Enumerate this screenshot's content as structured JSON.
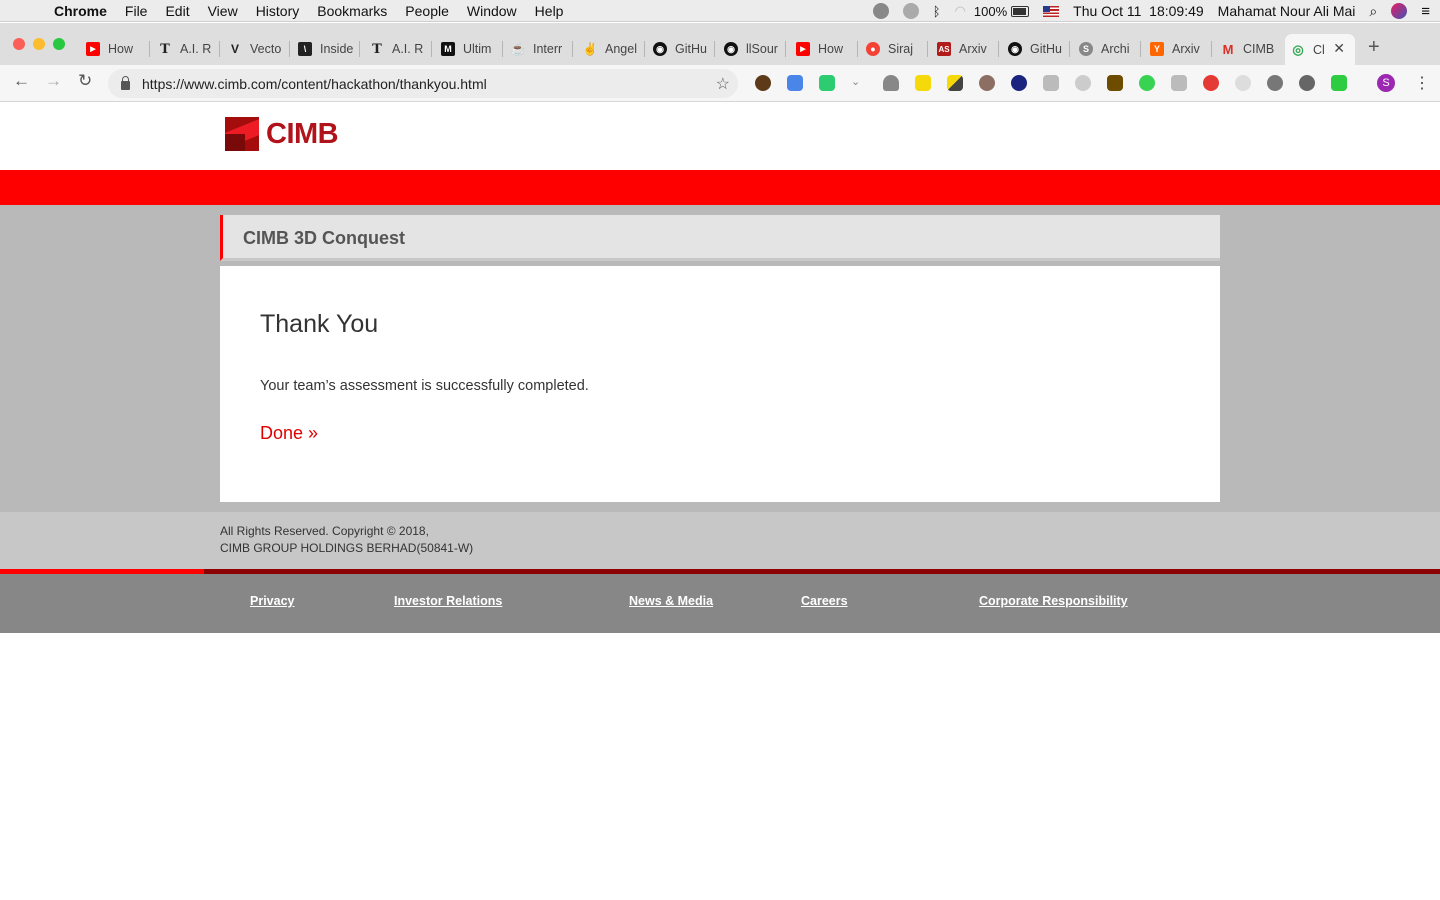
{
  "menubar": {
    "app": "Chrome",
    "menus": [
      "File",
      "Edit",
      "View",
      "History",
      "Bookmarks",
      "People",
      "Window",
      "Help"
    ],
    "battery": "100%",
    "datetime": "Thu Oct 11  18:09:49",
    "user": "Mahamat Nour Ali Mai"
  },
  "tabs": [
    {
      "title": "How",
      "color": "#ff0000",
      "glyph": "▶"
    },
    {
      "title": "A.I. R",
      "color": "#222222",
      "glyph": "T"
    },
    {
      "title": "Vecto",
      "color": "#ffffff",
      "glyph": "V"
    },
    {
      "title": "Inside",
      "color": "#222222",
      "glyph": "\\"
    },
    {
      "title": "A.I. R",
      "color": "#222222",
      "glyph": "T"
    },
    {
      "title": "Ultim",
      "color": "#111111",
      "glyph": "M"
    },
    {
      "title": "Interr",
      "color": "#999999",
      "glyph": "~"
    },
    {
      "title": "Angel",
      "color": "#777777",
      "glyph": "✌"
    },
    {
      "title": "GitHu",
      "color": "#111111",
      "glyph": "◉"
    },
    {
      "title": "llSour",
      "color": "#111111",
      "glyph": "◉"
    },
    {
      "title": "How",
      "color": "#ff0000",
      "glyph": "▶"
    },
    {
      "title": "Siraj",
      "color": "#f44336",
      "glyph": "●"
    },
    {
      "title": "Arxiv",
      "color": "#b31b1b",
      "glyph": "AS"
    },
    {
      "title": "GitHu",
      "color": "#111111",
      "glyph": "◉"
    },
    {
      "title": "Archi",
      "color": "#777777",
      "glyph": "S"
    },
    {
      "title": "Arxiv",
      "color": "#ff6600",
      "glyph": "Y"
    },
    {
      "title": "CIMB",
      "color": "#d93025",
      "glyph": "M"
    },
    {
      "title": "Cl",
      "color": "#34a853",
      "glyph": "◎",
      "active": true
    }
  ],
  "address_bar": {
    "url": "https://www.cimb.com/content/hackathon/thankyou.html"
  },
  "profile_initial": "S",
  "page": {
    "logo_text": "CIMB",
    "section_title": "CIMB 3D Conquest",
    "heading": "Thank You",
    "message": "Your team’s assessment is successfully completed.",
    "done_link": "Done »",
    "copyright_line1": "All Rights Reserved. Copyright © 2018,",
    "copyright_line2": "CIMB GROUP HOLDINGS BERHAD(50841-W)",
    "footer_links": [
      "Privacy",
      "Investor Relations",
      "News & Media",
      "Careers",
      "Corporate Responsibility"
    ]
  },
  "colors": {
    "brand_red": "#ff0000",
    "logo_red": "#b0131a",
    "link_red": "#e00000",
    "footer_gray": "#878787"
  }
}
